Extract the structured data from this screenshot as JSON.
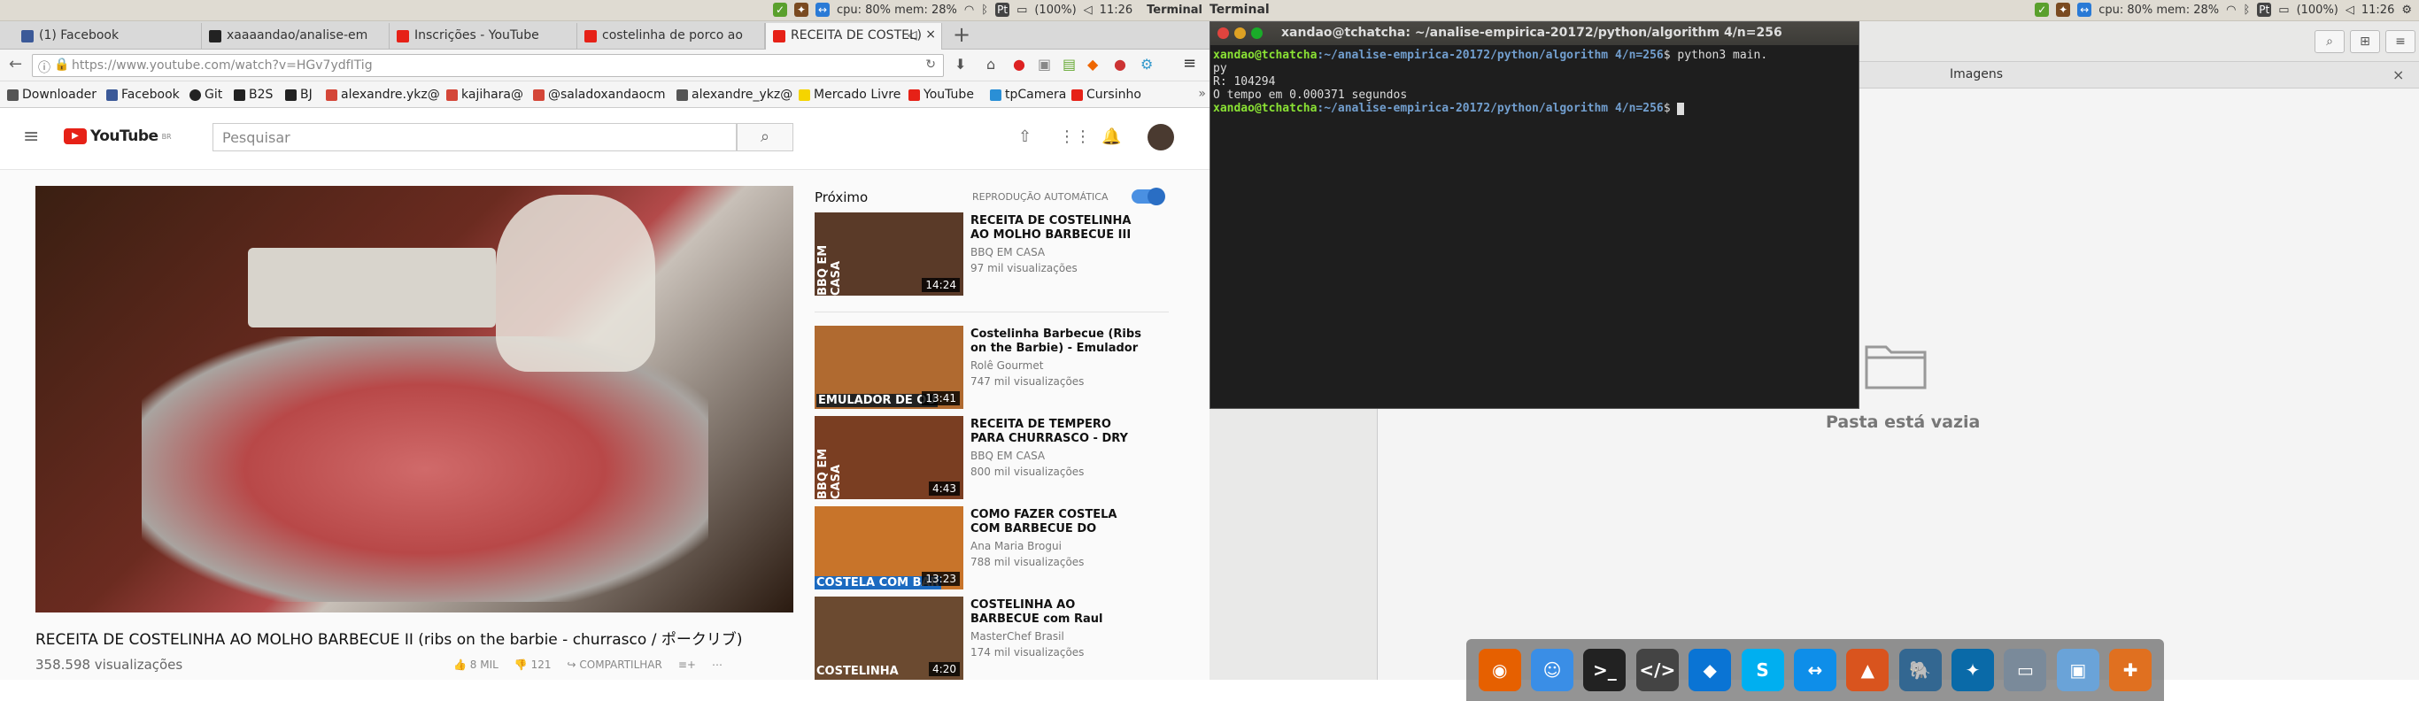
{
  "panel": {
    "cpu_mem": "cpu: 80% mem: 28%",
    "battery": "(100%)",
    "clock": "11:26",
    "app_title": "Terminal"
  },
  "browser": {
    "tabs": [
      {
        "label": "(1) Facebook",
        "color": "#3b5998"
      },
      {
        "label": "xaaaandao/analise-em",
        "color": "#222222"
      },
      {
        "label": "Inscrições - YouTube",
        "color": "#e62117"
      },
      {
        "label": "costelinha de porco ao",
        "color": "#e62117"
      },
      {
        "label": "RECEITA DE COSTEL",
        "color": "#e62117"
      }
    ],
    "url": "https://www.youtube.com/watch?v=HGv7ydfITig",
    "bookmarks": [
      {
        "label": "Downloader",
        "color": "#555555"
      },
      {
        "label": "Facebook",
        "color": "#3b5998"
      },
      {
        "label": "Git",
        "color": "#222222"
      },
      {
        "label": "B2S",
        "color": "#222222"
      },
      {
        "label": "BJ",
        "color": "#222222"
      },
      {
        "label": "alexandre.ykz@",
        "color": "#d44638"
      },
      {
        "label": "kajihara@",
        "color": "#d44638"
      },
      {
        "label": "@saladoxandaocm",
        "color": "#d44638"
      },
      {
        "label": "alexandre_ykz@",
        "color": "#555555"
      },
      {
        "label": "Mercado Livre",
        "color": "#f5d400"
      },
      {
        "label": "YouTube",
        "color": "#e62117"
      },
      {
        "label": "tpCamera",
        "color": "#2a8fd6"
      },
      {
        "label": "Cursinho",
        "color": "#e62117"
      }
    ]
  },
  "youtube": {
    "logo": "YouTube",
    "logo_region": "BR",
    "search_placeholder": "Pesquisar",
    "video_title": "RECEITA DE COSTELINHA AO MOLHO BARBECUE II (ribs on the barbie - churrasco / ポークリブ)",
    "views": "358.598 visualizações",
    "likes": "8 MIL",
    "dislikes": "121",
    "share": "COMPARTILHAR",
    "up_next": "Próximo",
    "autoplay": "REPRODUÇÃO AUTOMÁTICA",
    "recommendations": [
      {
        "title": "RECEITA DE COSTELINHA AO MOLHO BARBECUE III (ribs on",
        "channel": "BBQ EM CASA",
        "views": "97 mil visualizações",
        "duration": "14:24",
        "thumb": "BBQ EM CASA",
        "bg": "#5a3a28"
      },
      {
        "title": "Costelinha Barbecue (Ribs on the Barbie) - Emulador de",
        "channel": "Rolê Gourmet",
        "views": "747 mil visualizações",
        "duration": "13:41",
        "thumb": "EMULADOR DE OU",
        "bg": "#b06a30"
      },
      {
        "title": "RECEITA DE TEMPERO PARA CHURRASCO - DRY RUB",
        "channel": "BBQ EM CASA",
        "views": "800 mil visualizações",
        "duration": "4:43",
        "thumb": "BBQ EM CASA",
        "bg": "#7a3e22"
      },
      {
        "title": "COMO FAZER COSTELA COM BARBECUE DO APPLEBEE'S |",
        "channel": "Ana Maria Brogui",
        "views": "788 mil visualizações",
        "duration": "13:23",
        "thumb": "COSTELA COM BAR",
        "bg": "#c8742a"
      },
      {
        "title": "COSTELINHA AO BARBECUE com Raul Lemos | DICAS",
        "channel": "MasterChef Brasil",
        "views": "174 mil visualizações",
        "duration": "4:20",
        "thumb": "COSTELINHA",
        "bg": "#6b4a30"
      }
    ]
  },
  "terminal": {
    "title": "xandao@tchatcha: ~/analise-empirica-20172/python/algorithm 4/n=256",
    "user_host": "xandao@tchatcha",
    "path": ":~/analise-empirica-20172/python/algorithm 4/n=256",
    "command": "$ python3 main.",
    "command_cont": "py",
    "output1": "R: 104294",
    "output2": "O tempo em 0.000371 segundos",
    "prompt_end": "$ "
  },
  "files": {
    "tab_label": "Imagens",
    "empty_label": "Pasta está vazia"
  },
  "dock": [
    {
      "name": "firefox-icon",
      "glyph": "◉",
      "color": "#e66000"
    },
    {
      "name": "finder-icon",
      "glyph": "☺",
      "color": "#3a8ee6"
    },
    {
      "name": "terminal-icon",
      "glyph": ">_",
      "color": "#222222"
    },
    {
      "name": "code-editor-icon",
      "glyph": "</>",
      "color": "#444444"
    },
    {
      "name": "dropbox-icon",
      "glyph": "◆",
      "color": "#0a74d4"
    },
    {
      "name": "skype-icon",
      "glyph": "S",
      "color": "#00aff0"
    },
    {
      "name": "teamviewer-icon",
      "glyph": "↔",
      "color": "#0e8ee9"
    },
    {
      "name": "matlab-icon",
      "glyph": "▲",
      "color": "#d9541e"
    },
    {
      "name": "postgres-icon",
      "glyph": "🐘",
      "color": "#336791"
    },
    {
      "name": "mysql-workbench-icon",
      "glyph": "✦",
      "color": "#0a6aa8"
    },
    {
      "name": "disk-utility-icon",
      "glyph": "▭",
      "color": "#7a8a9a"
    },
    {
      "name": "virtualbox-icon",
      "glyph": "▣",
      "color": "#6aa3d8"
    },
    {
      "name": "scenebuilder-icon",
      "glyph": "✚",
      "color": "#e07020"
    }
  ]
}
